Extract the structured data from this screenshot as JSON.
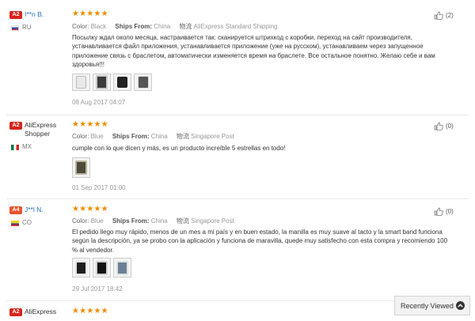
{
  "reviews": [
    {
      "level": "A2",
      "name": "I**n B.",
      "country": "RU",
      "color_label": "Color:",
      "color": "Black",
      "ships_label": "Ships From:",
      "ships_from": "China",
      "shipping_glyph": "物流",
      "shipping": "AliExpress Standard Shipping",
      "text": "Посылку ждал около месяца, настраивается так: сканируется штрихкод с коробки, переход на сайт производителя, устанавливается файл приложения, устанавливается приложение (уже на русском), устанавливаем через запущенное приложение связь с браслетом, автоматически изменяется время на браслете. Все остальное понятно. Желаю себе и вам здоровья!!!",
      "date": "08 Aug 2017 04:07",
      "helpful": "(2)",
      "photos": 4
    },
    {
      "level": "A2",
      "name": "AliExpress Shopper",
      "country": "MX",
      "color_label": "Color:",
      "color": "Blue",
      "ships_label": "Ships From:",
      "ships_from": "China",
      "shipping_glyph": "物流",
      "shipping": "Singapore Post",
      "text": "cumple con lo que dicen y más, es un producto increíble 5 estrellas en todo!",
      "date": "01 Sep 2017 01:00",
      "helpful": "(0)",
      "photos": 1
    },
    {
      "level": "A4",
      "name": "J**l N.",
      "country": "CO",
      "color_label": "Color:",
      "color": "Blue",
      "ships_label": "Ships From:",
      "ships_from": "China",
      "shipping_glyph": "物流",
      "shipping": "Singapore Post",
      "text": "El pedido llego muy rápido, menos de un mes a mi país y en buen estado, la manilla es muy suave al tacto y la smart band funciona según la descripción, ya se probo con la aplicación y funciona de maravilla, quede muy satisfecho con esta compra y recomiendo 100 % al vendedor.",
      "date": "29 Jul 2017 18:42",
      "helpful": "(0)",
      "photos": 3
    },
    {
      "level": "A2",
      "name": "AliExpress"
    }
  ],
  "stars": "★★★★★",
  "rating": 5,
  "recently_viewed": "Recently Viewed",
  "icons": {
    "helpful": "thumbs-up-icon",
    "up": "chevron-up-icon"
  }
}
